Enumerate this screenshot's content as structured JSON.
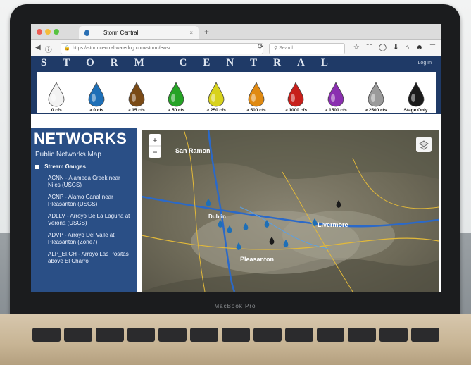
{
  "device": {
    "label": "MacBook Pro"
  },
  "browser": {
    "tab_title": "Storm Central",
    "tab_close": "×",
    "new_tab": "+",
    "url": "https://stormcentral.waterlog.com/storm/ews/",
    "search_placeholder": "Search"
  },
  "site": {
    "brand": "STORM CENTRAL",
    "login": "Log In",
    "legend": [
      {
        "label": "0 cfs",
        "color": "#f2f2f2"
      },
      {
        "label": "> 0 cfs",
        "color": "#1e6fb7"
      },
      {
        "label": "> 15 cfs",
        "color": "#7a4a16"
      },
      {
        "label": "> 50 cfs",
        "color": "#25a325"
      },
      {
        "label": "> 250 cfs",
        "color": "#d8d21c"
      },
      {
        "label": "> 500 cfs",
        "color": "#e08a12"
      },
      {
        "label": "> 1000 cfs",
        "color": "#c71f1a"
      },
      {
        "label": "> 1500 cfs",
        "color": "#8a2fb0"
      },
      {
        "label": "> 2500 cfs",
        "color": "#9a9a9a"
      },
      {
        "label": "Stage Only",
        "color": "#1a1a1a"
      }
    ]
  },
  "sidebar": {
    "title": "NETWORKS",
    "public_link": "Public Networks Map",
    "group": "Stream Gauges",
    "items": [
      "ACNN - Alameda Creek near Niles (USGS)",
      "ACNP - Alamo Canal near Pleasanton (USGS)",
      "ADLLV - Arroyo De La Laguna at Verona (USGS)",
      "ADVP - Arroyo Del Valle at Pleasanton (Zone7)",
      "ALP_EI.CH - Arroyo Las Positas above El Charro"
    ]
  },
  "map": {
    "zoom_in": "+",
    "zoom_out": "−",
    "labels": [
      "San Ramon",
      "Dublin",
      "Livermore",
      "Pleasanton"
    ]
  }
}
